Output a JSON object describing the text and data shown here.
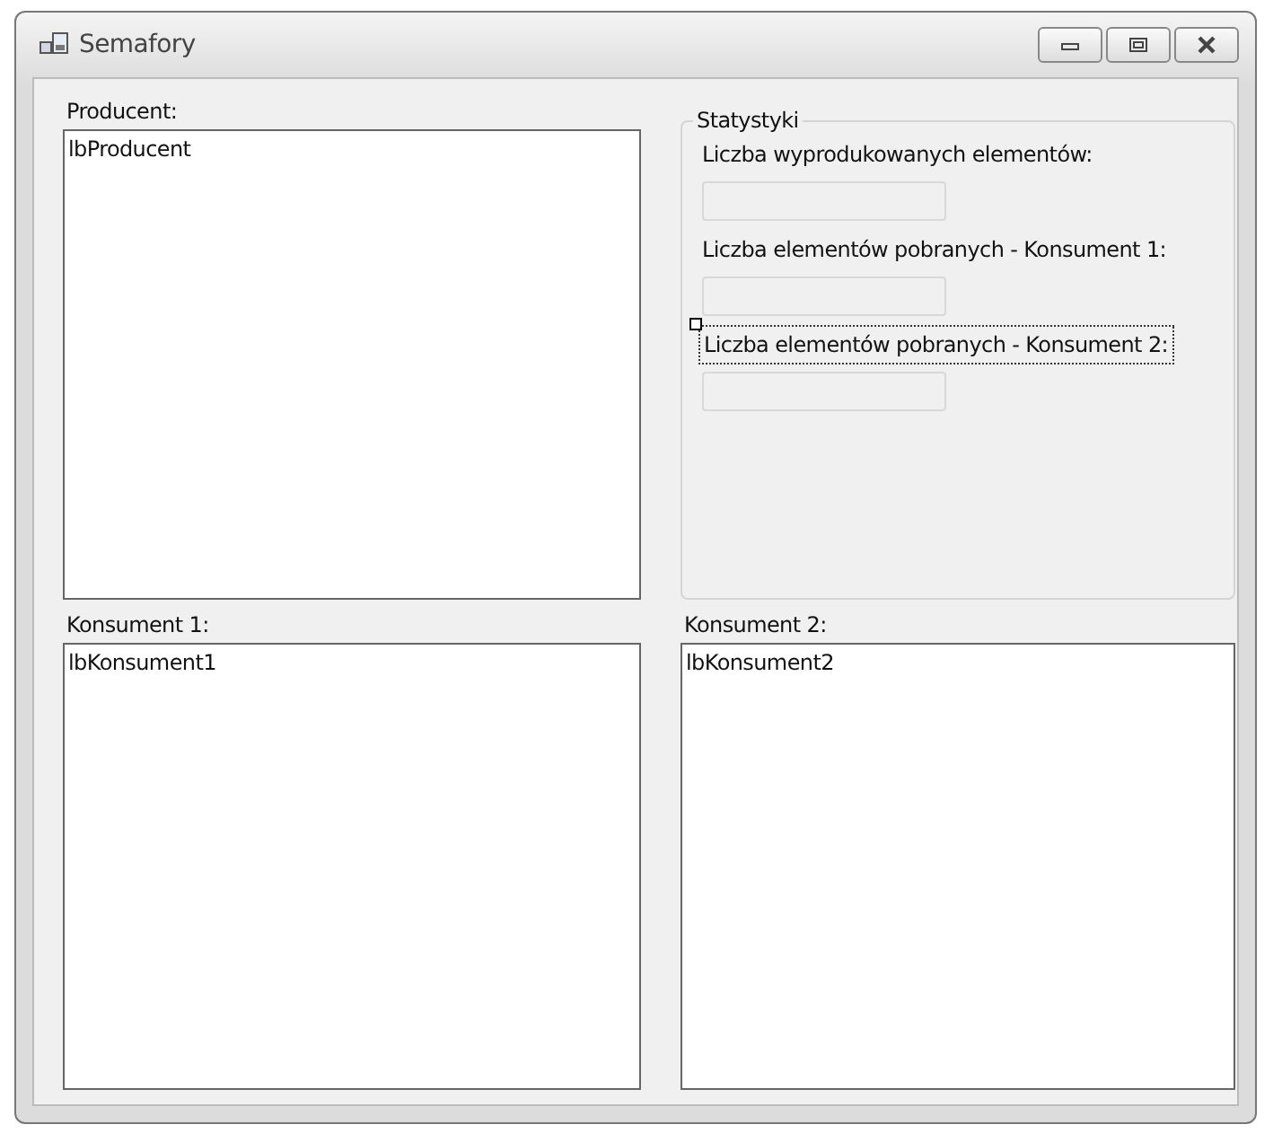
{
  "window": {
    "title": "Semafory"
  },
  "producer": {
    "label": "Producent:",
    "list_item": "lbProducent"
  },
  "stats": {
    "title": "Statystyki",
    "rows": [
      {
        "label": "Liczba wyprodukowanych elementów:",
        "selected": false
      },
      {
        "label": "Liczba elementów pobranych - Konsument 1:",
        "selected": false
      },
      {
        "label": "Liczba elementów pobranych - Konsument 2:",
        "selected": true
      }
    ]
  },
  "consumers": [
    {
      "label": "Konsument 1:",
      "list_item": "lbKonsument1"
    },
    {
      "label": "Konsument 2:",
      "list_item": "lbKonsument2"
    }
  ]
}
